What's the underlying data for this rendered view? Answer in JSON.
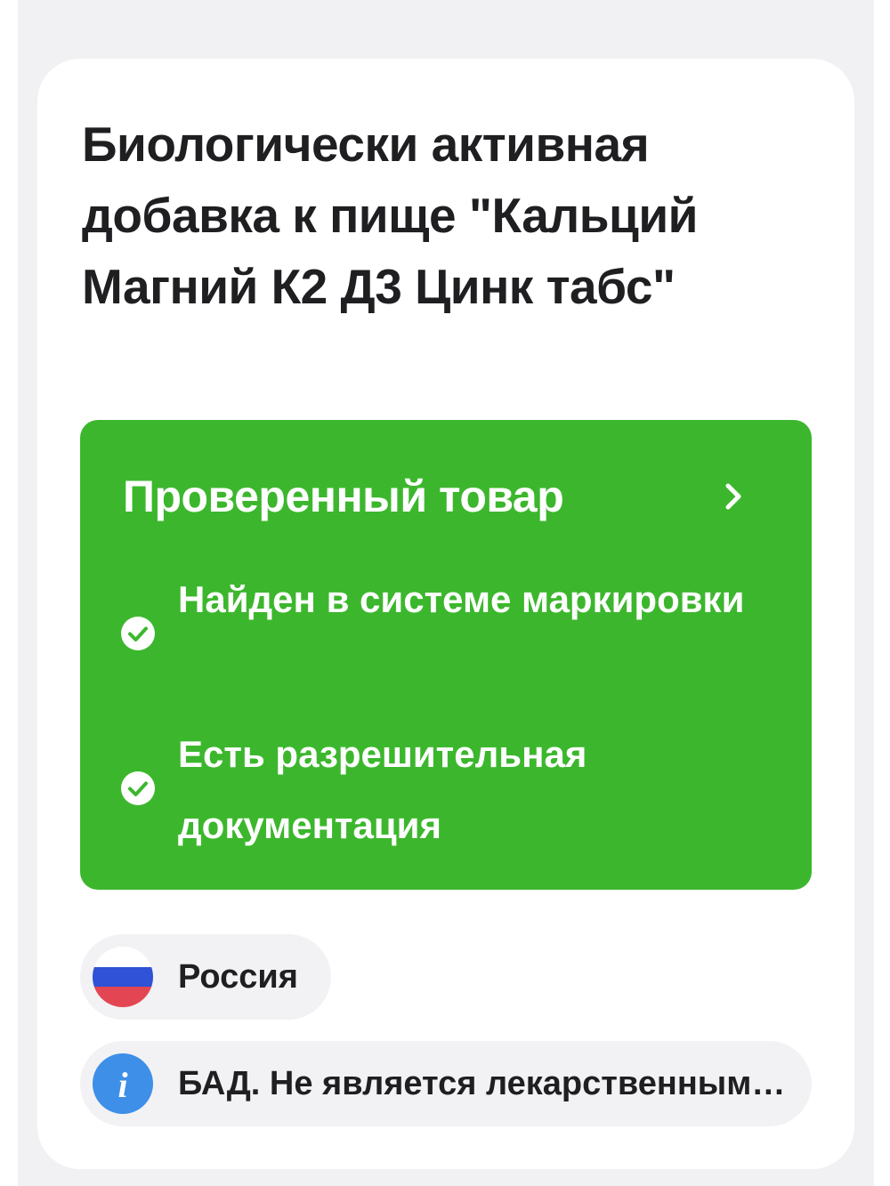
{
  "product": {
    "title": "Биологически активная добавка к пище \"Кальций Магний К2 Д3 Цинк табс\""
  },
  "verification": {
    "title": "Проверенный товар",
    "items": [
      {
        "text": "Найден в системе маркировки"
      },
      {
        "text": "Есть разрешительная документация"
      }
    ],
    "colors": {
      "background": "#3cb72d",
      "text": "#ffffff"
    }
  },
  "country": {
    "name": "Россия",
    "flag_icon": "russia-flag-icon"
  },
  "notice": {
    "text": "БАД. Не является лекарственным средством",
    "icon": "info-icon",
    "icon_color": "#3d8fe8"
  }
}
